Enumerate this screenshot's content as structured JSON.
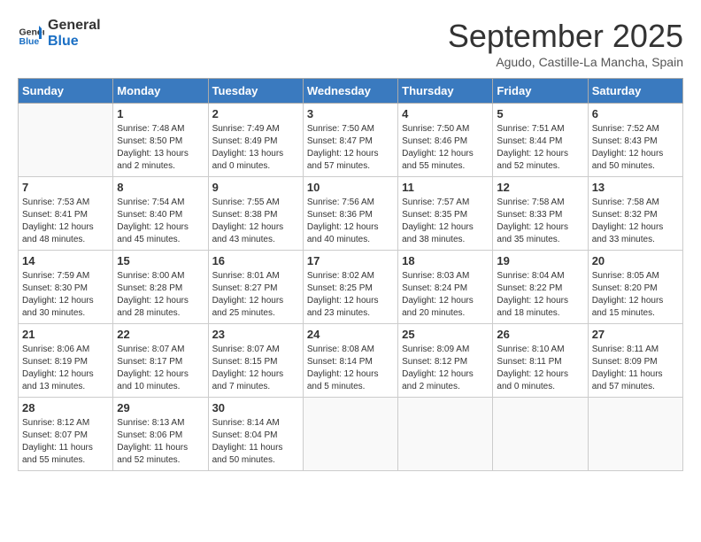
{
  "logo": {
    "general": "General",
    "blue": "Blue"
  },
  "title": "September 2025",
  "subtitle": "Agudo, Castille-La Mancha, Spain",
  "weekdays": [
    "Sunday",
    "Monday",
    "Tuesday",
    "Wednesday",
    "Thursday",
    "Friday",
    "Saturday"
  ],
  "weeks": [
    [
      {
        "day": "",
        "info": ""
      },
      {
        "day": "1",
        "info": "Sunrise: 7:48 AM\nSunset: 8:50 PM\nDaylight: 13 hours\nand 2 minutes."
      },
      {
        "day": "2",
        "info": "Sunrise: 7:49 AM\nSunset: 8:49 PM\nDaylight: 13 hours\nand 0 minutes."
      },
      {
        "day": "3",
        "info": "Sunrise: 7:50 AM\nSunset: 8:47 PM\nDaylight: 12 hours\nand 57 minutes."
      },
      {
        "day": "4",
        "info": "Sunrise: 7:50 AM\nSunset: 8:46 PM\nDaylight: 12 hours\nand 55 minutes."
      },
      {
        "day": "5",
        "info": "Sunrise: 7:51 AM\nSunset: 8:44 PM\nDaylight: 12 hours\nand 52 minutes."
      },
      {
        "day": "6",
        "info": "Sunrise: 7:52 AM\nSunset: 8:43 PM\nDaylight: 12 hours\nand 50 minutes."
      }
    ],
    [
      {
        "day": "7",
        "info": "Sunrise: 7:53 AM\nSunset: 8:41 PM\nDaylight: 12 hours\nand 48 minutes."
      },
      {
        "day": "8",
        "info": "Sunrise: 7:54 AM\nSunset: 8:40 PM\nDaylight: 12 hours\nand 45 minutes."
      },
      {
        "day": "9",
        "info": "Sunrise: 7:55 AM\nSunset: 8:38 PM\nDaylight: 12 hours\nand 43 minutes."
      },
      {
        "day": "10",
        "info": "Sunrise: 7:56 AM\nSunset: 8:36 PM\nDaylight: 12 hours\nand 40 minutes."
      },
      {
        "day": "11",
        "info": "Sunrise: 7:57 AM\nSunset: 8:35 PM\nDaylight: 12 hours\nand 38 minutes."
      },
      {
        "day": "12",
        "info": "Sunrise: 7:58 AM\nSunset: 8:33 PM\nDaylight: 12 hours\nand 35 minutes."
      },
      {
        "day": "13",
        "info": "Sunrise: 7:58 AM\nSunset: 8:32 PM\nDaylight: 12 hours\nand 33 minutes."
      }
    ],
    [
      {
        "day": "14",
        "info": "Sunrise: 7:59 AM\nSunset: 8:30 PM\nDaylight: 12 hours\nand 30 minutes."
      },
      {
        "day": "15",
        "info": "Sunrise: 8:00 AM\nSunset: 8:28 PM\nDaylight: 12 hours\nand 28 minutes."
      },
      {
        "day": "16",
        "info": "Sunrise: 8:01 AM\nSunset: 8:27 PM\nDaylight: 12 hours\nand 25 minutes."
      },
      {
        "day": "17",
        "info": "Sunrise: 8:02 AM\nSunset: 8:25 PM\nDaylight: 12 hours\nand 23 minutes."
      },
      {
        "day": "18",
        "info": "Sunrise: 8:03 AM\nSunset: 8:24 PM\nDaylight: 12 hours\nand 20 minutes."
      },
      {
        "day": "19",
        "info": "Sunrise: 8:04 AM\nSunset: 8:22 PM\nDaylight: 12 hours\nand 18 minutes."
      },
      {
        "day": "20",
        "info": "Sunrise: 8:05 AM\nSunset: 8:20 PM\nDaylight: 12 hours\nand 15 minutes."
      }
    ],
    [
      {
        "day": "21",
        "info": "Sunrise: 8:06 AM\nSunset: 8:19 PM\nDaylight: 12 hours\nand 13 minutes."
      },
      {
        "day": "22",
        "info": "Sunrise: 8:07 AM\nSunset: 8:17 PM\nDaylight: 12 hours\nand 10 minutes."
      },
      {
        "day": "23",
        "info": "Sunrise: 8:07 AM\nSunset: 8:15 PM\nDaylight: 12 hours\nand 7 minutes."
      },
      {
        "day": "24",
        "info": "Sunrise: 8:08 AM\nSunset: 8:14 PM\nDaylight: 12 hours\nand 5 minutes."
      },
      {
        "day": "25",
        "info": "Sunrise: 8:09 AM\nSunset: 8:12 PM\nDaylight: 12 hours\nand 2 minutes."
      },
      {
        "day": "26",
        "info": "Sunrise: 8:10 AM\nSunset: 8:11 PM\nDaylight: 12 hours\nand 0 minutes."
      },
      {
        "day": "27",
        "info": "Sunrise: 8:11 AM\nSunset: 8:09 PM\nDaylight: 11 hours\nand 57 minutes."
      }
    ],
    [
      {
        "day": "28",
        "info": "Sunrise: 8:12 AM\nSunset: 8:07 PM\nDaylight: 11 hours\nand 55 minutes."
      },
      {
        "day": "29",
        "info": "Sunrise: 8:13 AM\nSunset: 8:06 PM\nDaylight: 11 hours\nand 52 minutes."
      },
      {
        "day": "30",
        "info": "Sunrise: 8:14 AM\nSunset: 8:04 PM\nDaylight: 11 hours\nand 50 minutes."
      },
      {
        "day": "",
        "info": ""
      },
      {
        "day": "",
        "info": ""
      },
      {
        "day": "",
        "info": ""
      },
      {
        "day": "",
        "info": ""
      }
    ]
  ]
}
